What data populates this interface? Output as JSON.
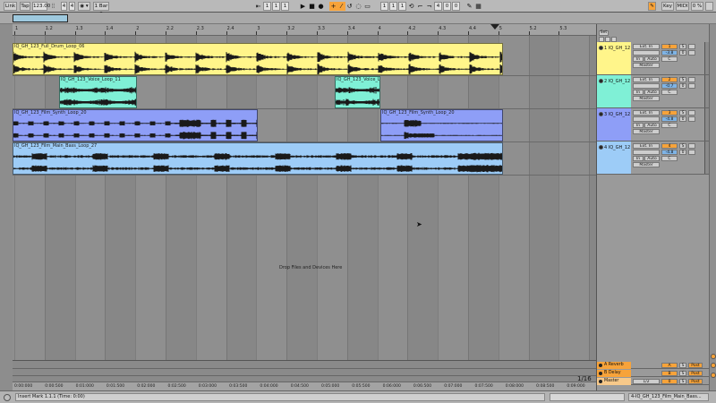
{
  "transport": {
    "link": "Link",
    "tap": "Tap",
    "tempo": "123.00",
    "sig_num": "4",
    "sig_den": "4",
    "metro": "◉ ▾",
    "quantize": "1 Bar ▾",
    "pos1": "1",
    "pos2": "1",
    "pos3": "1",
    "loop1": "1",
    "loop2": "1",
    "loop3": "1",
    "len1": "4",
    "len2": "0",
    "len3": "0",
    "key": "Key",
    "midi": "MIDI",
    "cpu": "0 %"
  },
  "ruler": {
    "labels": [
      "1",
      "1.2",
      "1.3",
      "1.4",
      "2",
      "2.2",
      "2.3",
      "2.4",
      "3",
      "3.2",
      "3.3",
      "3.4",
      "4",
      "4.2",
      "4.3",
      "4.4",
      "5",
      "5.2",
      "5.3"
    ]
  },
  "tracks": [
    {
      "color": "#fff58a",
      "clips": [
        {
          "name": "IQ_GH_123_Full_Drum_Loop_06"
        }
      ],
      "mixer": {
        "name": "1 IQ_GH_12",
        "input": "Ext. In",
        "channel": "1",
        "number": "1",
        "volume": "-3.8",
        "pan": "C",
        "s1": "S",
        "s2": "0"
      }
    },
    {
      "color": "#7ff0d6",
      "clips": [
        {
          "name": "IQ_GH_123_Voice_Loop_11"
        },
        {
          "name": "IQ_GH_123_Voice_Loop"
        }
      ],
      "mixer": {
        "name": "2 IQ_GH_12",
        "input": "Ext. In",
        "channel": "2",
        "number": "2",
        "volume": "-0.7",
        "pan": "C",
        "s1": "S",
        "s2": "0"
      }
    },
    {
      "color": "#8e9ef7",
      "clips": [
        {
          "name": "IQ_GH_123_Film_Synth_Loop_20"
        },
        {
          "name": "IQ_GH_123_Film_Synth_Loop_20"
        }
      ],
      "mixer": {
        "name": "3 IQ_GH_12",
        "input": "Ext. In",
        "channel": "3",
        "number": "3",
        "volume": "-4.8",
        "pan": "C",
        "s1": "S",
        "s2": "0"
      }
    },
    {
      "color": "#9dccf7",
      "clips": [
        {
          "name": "IQ_GH_123_Film_Main_Bass_Loop_27"
        }
      ],
      "mixer": {
        "name": "4 IQ_GH_12",
        "input": "Ext. In",
        "channel": "4",
        "number": "4",
        "volume": "-4.8",
        "pan": "C",
        "s1": "S",
        "s2": "0"
      }
    }
  ],
  "mixer_common": {
    "master_label": "Master",
    "off": "Off",
    "in": "In",
    "auto": "Auto"
  },
  "arrangement": {
    "drop_text": "Drop Files and Devices Here"
  },
  "returns": [
    {
      "name": "A Reverb",
      "number": "A",
      "s": "S",
      "pre": "Post"
    },
    {
      "name": "B Delay",
      "number": "B",
      "s": "S",
      "pre": "Post"
    },
    {
      "name": "Master",
      "number": "0",
      "cue": "1/2",
      "s": "S",
      "pre": "Post"
    }
  ],
  "time_ruler": {
    "labels": [
      "0:00:000",
      "0:00:500",
      "0:01:000",
      "0:01:500",
      "0:02:000",
      "0:02:500",
      "0:03:000",
      "0:03:500",
      "0:04:000",
      "0:04:500",
      "0:05:000",
      "0:05:500",
      "0:06:000",
      "0:06:500",
      "0:07:000",
      "0:07:500",
      "0:08:000",
      "0:08:500",
      "0:09:000"
    ]
  },
  "zoom": "1/16",
  "status": {
    "text": "Insert Mark 1.1.1 (Time: 0:00)",
    "track": "4-IQ_GH_123_Film_Main_Bass..."
  },
  "mixer_header": {
    "set": "Set"
  }
}
